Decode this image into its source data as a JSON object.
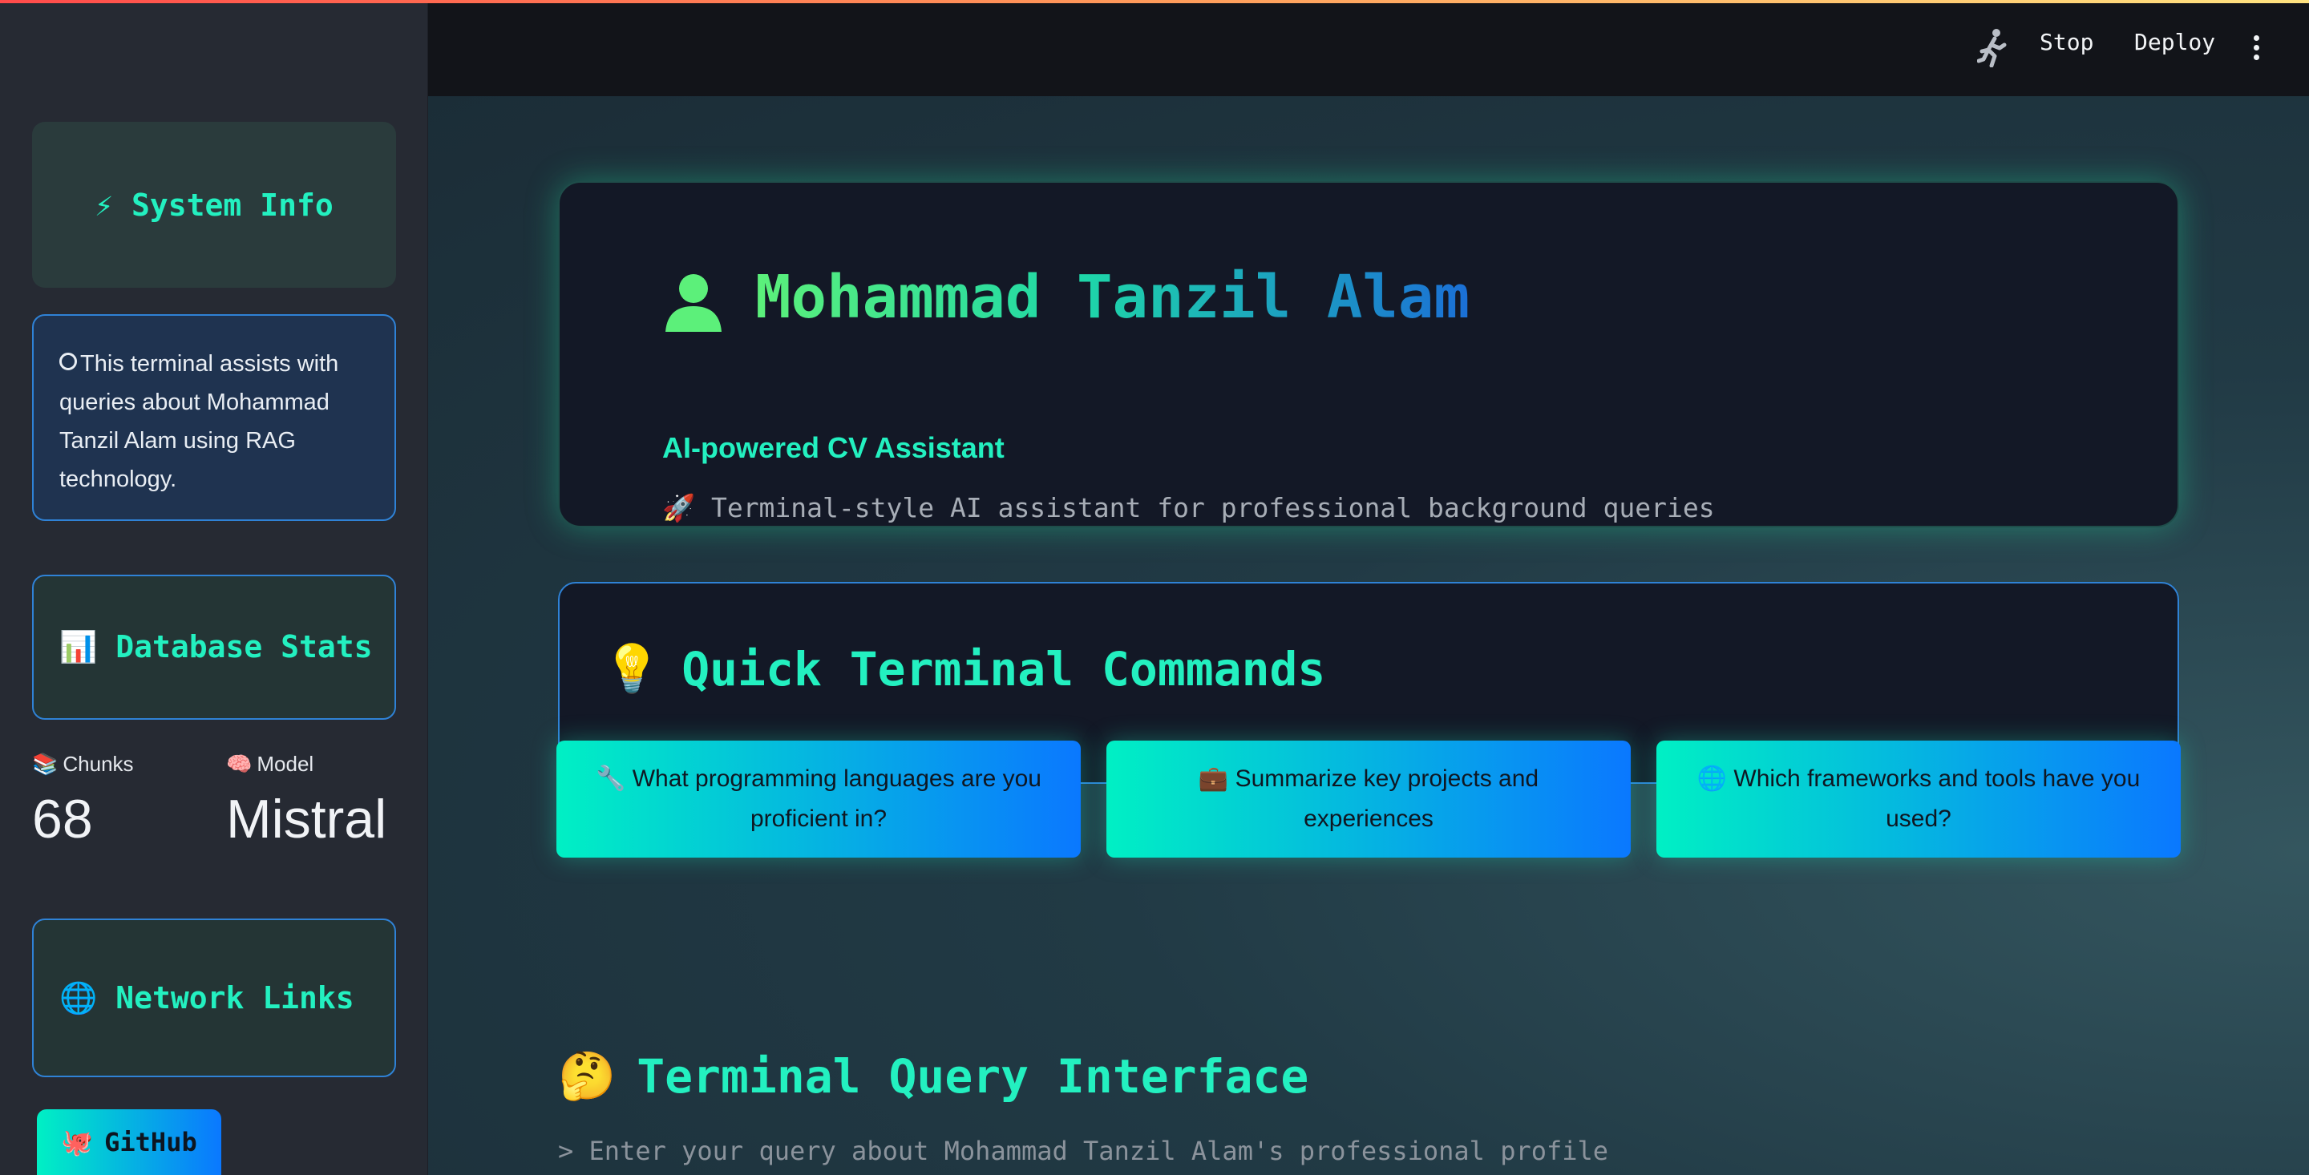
{
  "header": {
    "stop_label": "Stop",
    "deploy_label": "Deploy",
    "running_icon": "running-man-icon",
    "menu_icon": "kebab-menu-icon"
  },
  "sidebar": {
    "system_info": {
      "icon": "⚡",
      "title": "System Info"
    },
    "info_text": "This terminal assists with queries about Mohammad Tanzil Alam using RAG technology.",
    "database_stats": {
      "icon": "📊",
      "title": "Database Stats"
    },
    "metrics": [
      {
        "icon": "📚",
        "label": "Chunks",
        "value": "68"
      },
      {
        "icon": "🧠",
        "label": "Model",
        "value": "Mistral"
      }
    ],
    "network_links": {
      "icon": "🌐",
      "title": "Network Links"
    },
    "github": {
      "icon": "🐙",
      "label": "GitHub"
    }
  },
  "hero": {
    "name": "Mohammad Tanzil Alam",
    "subtitle": "AI-powered CV Assistant",
    "description": "🚀 Terminal-style AI assistant for professional background queries"
  },
  "quick_commands": {
    "icon": "💡",
    "title": "Quick Terminal Commands",
    "buttons": [
      {
        "icon": "🔧",
        "label": "What programming languages are you proficient in?"
      },
      {
        "icon": "💼",
        "label": "Summarize key projects and experiences"
      },
      {
        "icon": "🌐",
        "label": "Which frameworks and tools have you used?"
      }
    ]
  },
  "query": {
    "icon": "🤔",
    "title": "Terminal Query Interface",
    "placeholder": "> Enter your query about Mohammad Tanzil Alam's professional profile"
  },
  "colors": {
    "accent": "#23f0c0",
    "border_blue": "#2f82d6",
    "gradient_start": "#00f0c4",
    "gradient_end": "#0a78ff"
  }
}
